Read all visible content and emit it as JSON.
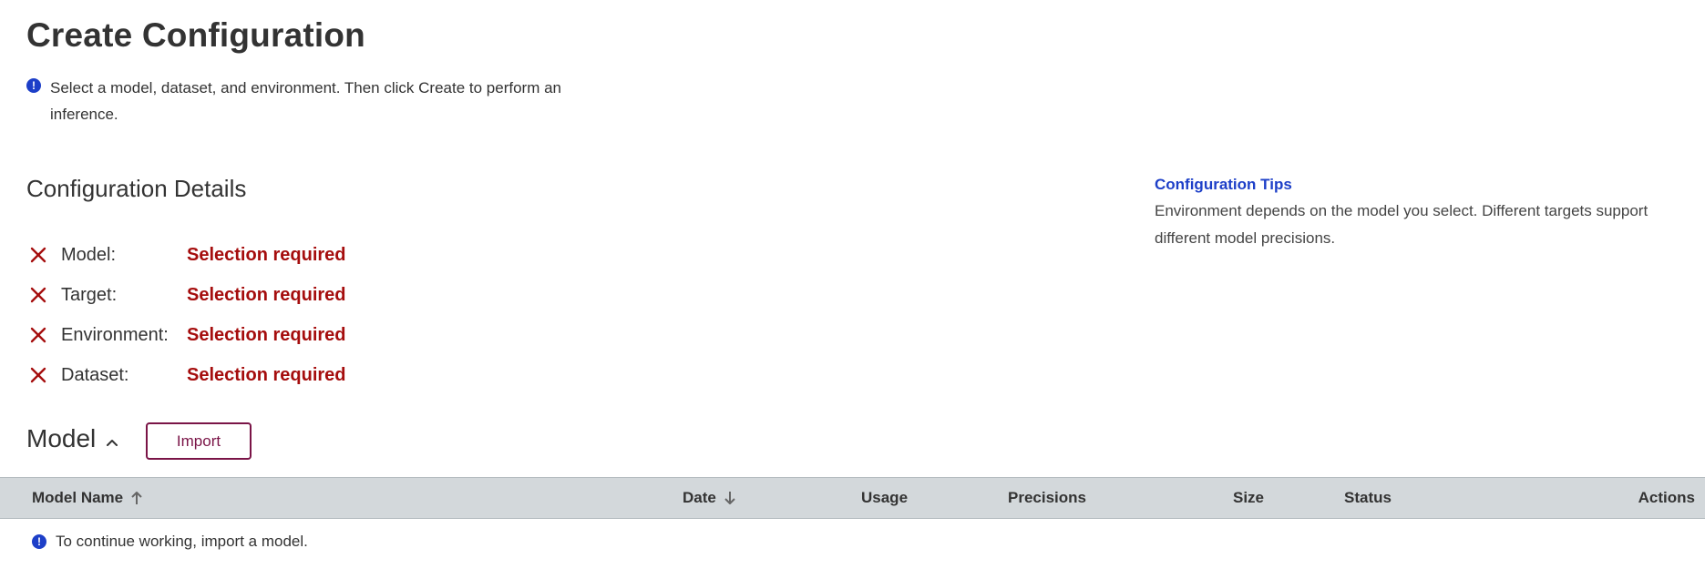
{
  "page": {
    "title": "Create Configuration",
    "intro": "Select a model, dataset, and environment. Then click Create to perform an inference.",
    "info_icon": "info-icon"
  },
  "details": {
    "title": "Configuration Details",
    "status_icon": "close-icon",
    "items": [
      {
        "label": "Model:",
        "value": "Selection required"
      },
      {
        "label": "Target:",
        "value": "Selection required"
      },
      {
        "label": "Environment:",
        "value": "Selection required"
      },
      {
        "label": "Dataset:",
        "value": "Selection required"
      }
    ]
  },
  "tips": {
    "title": "Configuration Tips",
    "text": "Environment depends on the model you select. Different targets support different model precisions."
  },
  "model_section": {
    "title": "Model",
    "import_label": "Import",
    "collapse_icon": "chevron-up-icon"
  },
  "table": {
    "columns": {
      "name": "Model Name",
      "date": "Date",
      "usage": "Usage",
      "precisions": "Precisions",
      "size": "Size",
      "status": "Status",
      "actions": "Actions"
    },
    "sort": {
      "name": "ascending",
      "date": "descending"
    },
    "empty_message": "To continue working, import a model."
  },
  "colors": {
    "accent_blue": "#1d3fc8",
    "error_red": "#a50d0d",
    "brand_maroon": "#7a1447",
    "header_gray": "#d3d8db"
  }
}
